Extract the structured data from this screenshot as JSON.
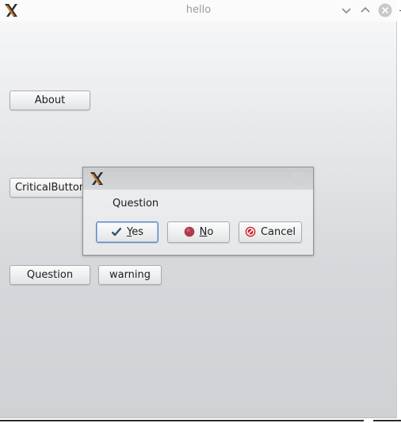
{
  "window": {
    "title": "hello",
    "icon": "x-app-icon",
    "controls": [
      "minimize-icon",
      "maximize-icon",
      "close-icon"
    ]
  },
  "buttons": {
    "about": "About",
    "critical": "CriticalButton",
    "question": "Question",
    "warning": "warning"
  },
  "dialog": {
    "icon": "x-app-icon",
    "message": "Question",
    "yes": {
      "mnemonic": "Y",
      "rest": "es",
      "icon": "checkmark-icon"
    },
    "no": {
      "mnemonic": "N",
      "rest": "o",
      "icon": "no-circle-icon"
    },
    "cancel": {
      "text": "Cancel",
      "icon": "cancel-icon"
    }
  },
  "colors": {
    "focus_border": "#5a86c2",
    "close_button": "#c8c8c8",
    "cancel_icon": "#cc1a1a",
    "no_icon": "#b03a4a",
    "check_icon": "#2f4f7a"
  }
}
